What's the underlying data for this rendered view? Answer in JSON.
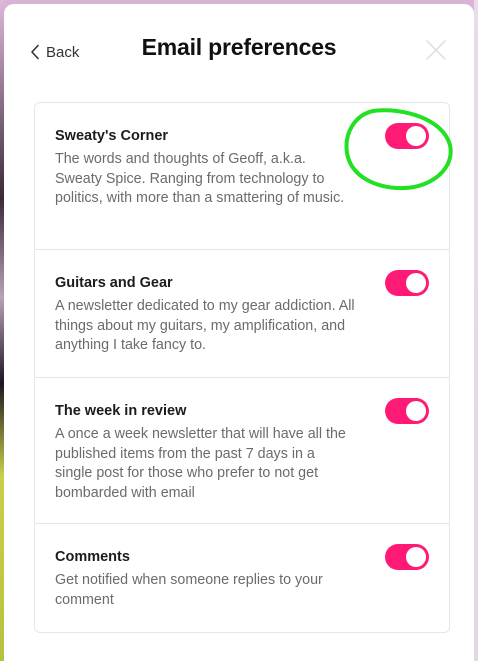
{
  "header": {
    "back_label": "Back",
    "title": "Email preferences"
  },
  "newsletters": [
    {
      "name": "Sweaty's Corner",
      "description": "The words and thoughts of Geoff, a.k.a. Sweaty Spice. Ranging from technology to politics, with more than a smattering of music.",
      "subscribed": true
    },
    {
      "name": "Guitars and Gear",
      "description": "A newsletter dedicated to my gear addiction. All things about my guitars, my amplification, and anything I take fancy to.",
      "subscribed": true
    },
    {
      "name": "The week in review",
      "description": "A once a week newsletter that will have all the published items from the past 7 days in a single post for those who prefer to not get bombarded with email",
      "subscribed": true
    },
    {
      "name": "Comments",
      "description": "Get notified when someone replies to your comment",
      "subscribed": true
    }
  ],
  "colors": {
    "toggle_on": "#ff1a76",
    "annotation": "#22e022",
    "title": "#111111",
    "description": "#6b6b6b"
  },
  "icons": {
    "back": "chevron-left-icon",
    "close": "close-icon"
  }
}
